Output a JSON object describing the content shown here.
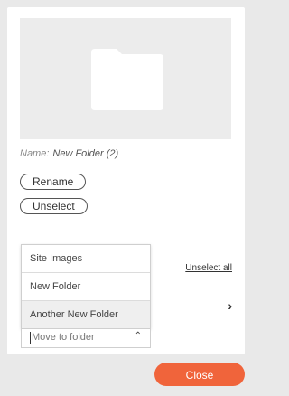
{
  "details": {
    "name_label": "Name:",
    "name_value": "New Folder (2)",
    "rename_label": "Rename",
    "unselect_label": "Unselect"
  },
  "toolbar": {
    "unselect_all_label": "Unselect all",
    "next_icon": "chevron-right-icon"
  },
  "move": {
    "options": [
      "Site Images",
      "New Folder",
      "Another New Folder"
    ],
    "highlighted_option": "Another New Folder",
    "placeholder": "Move to folder",
    "chevron_icon": "chevron-up-icon"
  },
  "footer": {
    "close_label": "Close",
    "close_color": "#f0643b"
  }
}
